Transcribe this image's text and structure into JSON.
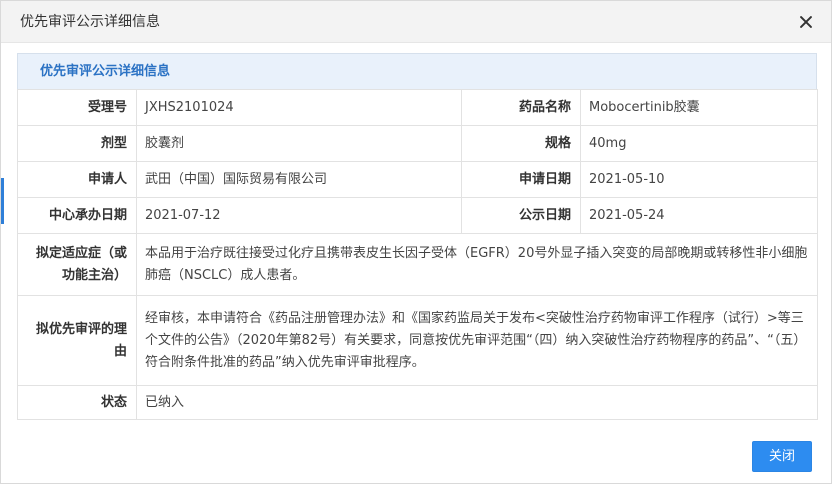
{
  "dialog": {
    "title": "优先审评公示详细信息",
    "close_button_label": "关闭"
  },
  "section": {
    "title": "优先审评公示详细信息"
  },
  "fields": {
    "acceptance_no": {
      "label": "受理号",
      "value": "JXHS2101024"
    },
    "drug_name": {
      "label": "药品名称",
      "value": "Mobocertinib胶囊"
    },
    "dosage_form": {
      "label": "剂型",
      "value": "胶囊剂"
    },
    "spec": {
      "label": "规格",
      "value": "40mg"
    },
    "applicant": {
      "label": "申请人",
      "value": "武田（中国）国际贸易有限公司"
    },
    "apply_date": {
      "label": "申请日期",
      "value": "2021-05-10"
    },
    "center_date": {
      "label": "中心承办日期",
      "value": "2021-07-12"
    },
    "publish_date": {
      "label": "公示日期",
      "value": "2021-05-24"
    },
    "indication": {
      "label": "拟定适应症（或功能主治）",
      "value": "本品用于治疗既往接受过化疗且携带表皮生长因子受体（EGFR）20号外显子插入突变的局部晚期或转移性非小细胞肺癌（NSCLC）成人患者。"
    },
    "reason": {
      "label": "拟优先审评的理由",
      "value": "经审核，本申请符合《药品注册管理办法》和《国家药监局关于发布<突破性治疗药物审评工作程序（试行）>等三个文件的公告》（2020年第82号）有关要求，同意按优先审评范围“（四）纳入突破性治疗药物程序的药品”、“（五）符合附条件批准的药品”纳入优先审评审批程序。"
    },
    "status": {
      "label": "状态",
      "value": "已纳入"
    }
  },
  "colors": {
    "accent": "#2d8cf0",
    "section_title": "#2b72c4",
    "section_bg": "#e9f1fb"
  }
}
